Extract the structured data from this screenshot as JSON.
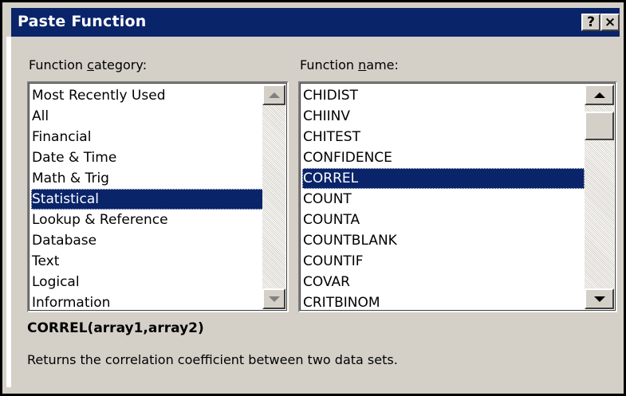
{
  "window": {
    "title": "Paste Function",
    "help_label": "?",
    "close_label": "×"
  },
  "category": {
    "label_before": "Function ",
    "label_accel": "c",
    "label_after": "ategory:",
    "items": [
      "Most Recently Used",
      "All",
      "Financial",
      "Date & Time",
      "Math & Trig",
      "Statistical",
      "Lookup & Reference",
      "Database",
      "Text",
      "Logical",
      "Information"
    ],
    "selected": "Statistical"
  },
  "function": {
    "label_before": "Function ",
    "label_accel": "n",
    "label_after": "ame:",
    "items": [
      "CHIDIST",
      "CHIINV",
      "CHITEST",
      "CONFIDENCE",
      "CORREL",
      "COUNT",
      "COUNTA",
      "COUNTBLANK",
      "COUNTIF",
      "COVAR",
      "CRITBINOM"
    ],
    "selected": "CORREL"
  },
  "syntax": "CORREL(array1,array2)",
  "description": "Returns the correlation coefficient between two data sets.",
  "colors": {
    "title_bar": "#0a246a",
    "selection": "#0a246a",
    "face": "#d4d0c8"
  },
  "icons": [
    "help-icon",
    "close-icon",
    "scroll-up-arrow-icon",
    "scroll-down-arrow-icon"
  ]
}
